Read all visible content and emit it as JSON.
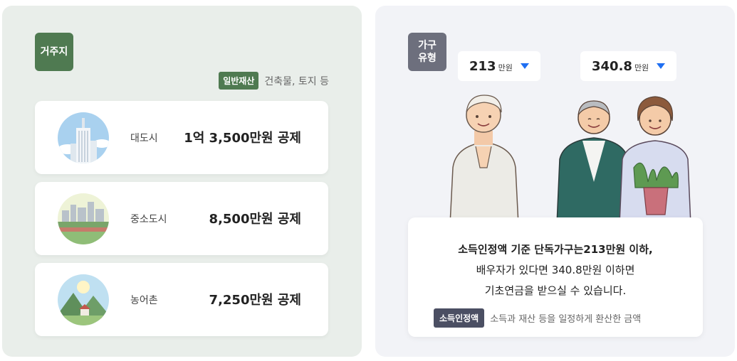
{
  "residence": {
    "tag": "거주지",
    "legend_chip": "일반재산",
    "legend_text": "건축물, 토지 등",
    "cards": [
      {
        "label": "대도시",
        "value": "1억 3,500만원 공제",
        "icon": "city-icon"
      },
      {
        "label": "중소도시",
        "value": "8,500만원 공제",
        "icon": "town-icon"
      },
      {
        "label": "농어촌",
        "value": "7,250만원 공제",
        "icon": "village-icon"
      }
    ]
  },
  "household": {
    "tag": "가구\n유형",
    "tag_line1": "가구",
    "tag_line2": "유형",
    "single": {
      "amount": "213",
      "unit": "만원"
    },
    "couple": {
      "amount": "340.8",
      "unit": "만원"
    },
    "info_line1": "소득인정액 기준 단독가구는213만원 이하,",
    "info_line2": "배우자가 있다면 340.8만원 이하면",
    "info_line3": "기초연금을 받으실 수 있습니다.",
    "footnote_chip": "소득인정액",
    "footnote_text": "소득과 재산 등을 일정하게 환산한 금액"
  },
  "colors": {
    "green": "#4f7a51",
    "gray_tag": "#6d6f7d",
    "accent_blue": "#1f6ff2",
    "dark_chip": "#4b4f63"
  }
}
